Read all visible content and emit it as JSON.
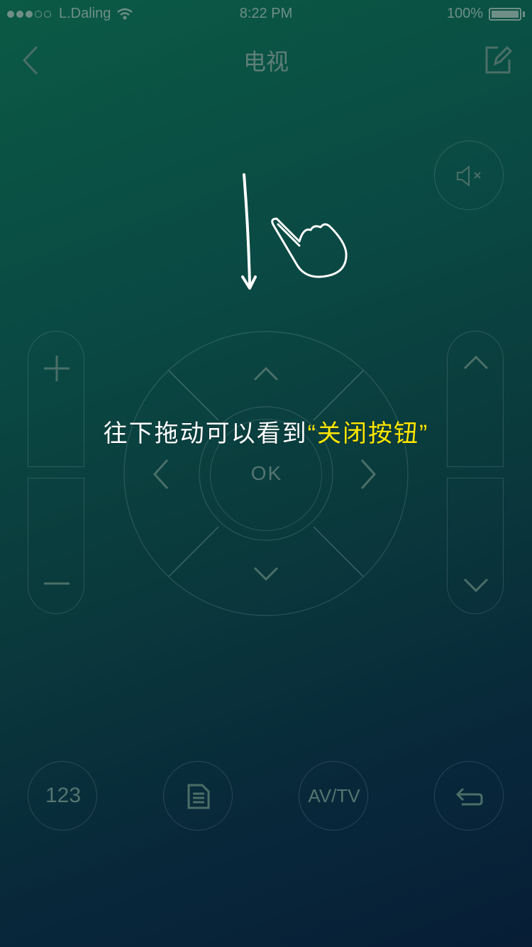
{
  "status_bar": {
    "carrier": "L.Daling",
    "time": "8:22 PM",
    "battery": "100%"
  },
  "nav": {
    "title": "电视",
    "back_icon": "chevron-left-icon",
    "edit_icon": "edit-icon"
  },
  "remote": {
    "mute_icon": "mute-icon",
    "ok_label": "OK",
    "volume_up_icon": "plus-icon",
    "volume_down_icon": "minus-icon",
    "channel_up_icon": "chevron-up-icon",
    "channel_down_icon": "chevron-down-icon"
  },
  "hint": {
    "prefix": "往下拖动可以看到",
    "highlight": "“关闭按钮”"
  },
  "bottom_buttons": {
    "numpad_label": "123",
    "menu_icon": "document-icon",
    "av_tv_label": "AV/TV",
    "return_icon": "return-icon"
  },
  "colors": {
    "highlight": "#ffe700",
    "dim_stroke": "#4b6f67"
  }
}
